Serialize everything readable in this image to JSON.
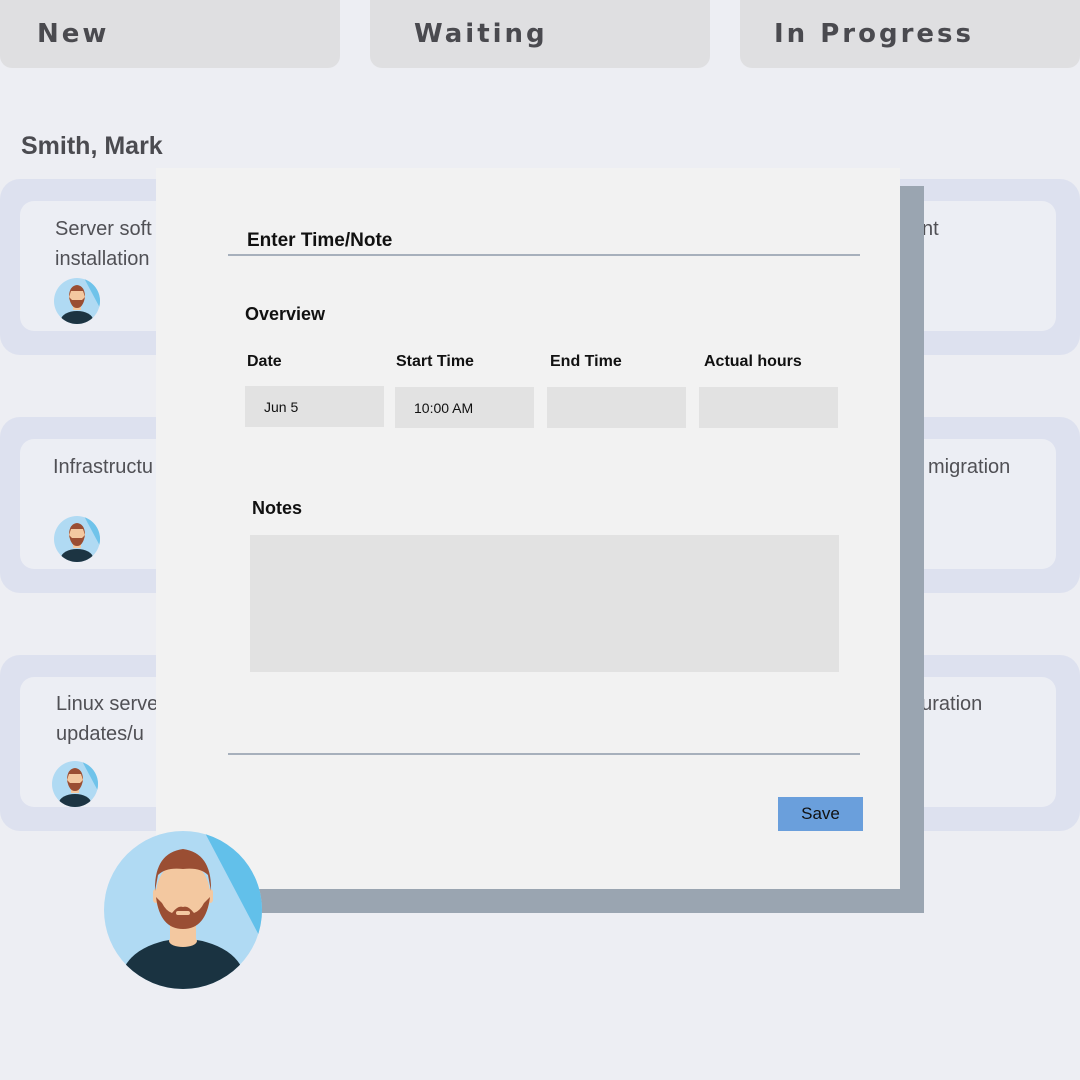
{
  "columns": [
    "New",
    "Waiting",
    "In Progress"
  ],
  "owner_name": "Smith, Mark",
  "cards_left": [
    {
      "title": "Server soft\ninstallation"
    },
    {
      "title": "Infrastructu"
    },
    {
      "title": "Linux serve\nupdates/u"
    }
  ],
  "cards_right": [
    {
      "title": "nt"
    },
    {
      "title": "migration"
    },
    {
      "title": "guration"
    }
  ],
  "modal": {
    "title": "Enter Time/Note",
    "overview_label": "Overview",
    "fields": {
      "date_label": "Date",
      "start_label": "Start Time",
      "end_label": "End Time",
      "hours_label": "Actual hours",
      "date_value": "Jun 5",
      "start_value": "10:00 AM",
      "end_value": "",
      "hours_value": ""
    },
    "notes_label": "Notes",
    "notes_value": "",
    "save_label": "Save"
  },
  "colors": {
    "background": "#edeef3",
    "save_button": "#6a9fdc",
    "modal_shadow": "#9aa5b1",
    "card_outer": "#dde1ef"
  },
  "icons": [
    "avatar-icon"
  ]
}
